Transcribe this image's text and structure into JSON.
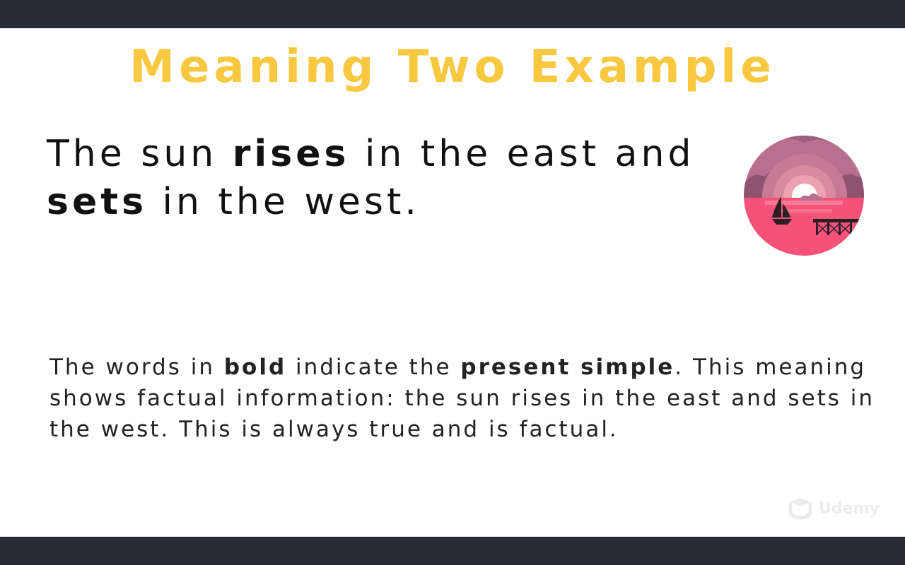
{
  "slide": {
    "title": "Meaning Two Example",
    "sentence": {
      "part1": "The sun ",
      "bold1": "rises",
      "part2": " in the east and",
      "bold2": "sets",
      "part3": " in the west."
    },
    "explanation": {
      "part1": "The words in ",
      "bold1": "bold",
      "part2": " indicate the ",
      "bold2": "present simple",
      "part3": ". This meaning shows factual information: the sun rises in the east and sets in the west. This is always true and is factual."
    },
    "illustration_icon": "sunset-boat-pier-icon",
    "watermark": "Udemy"
  },
  "colors": {
    "title": "#f8c840",
    "frame_bar": "#262c35",
    "text": "#111111",
    "sunset_pink": "#f5527a",
    "sky_mauve": "#b8708e"
  }
}
